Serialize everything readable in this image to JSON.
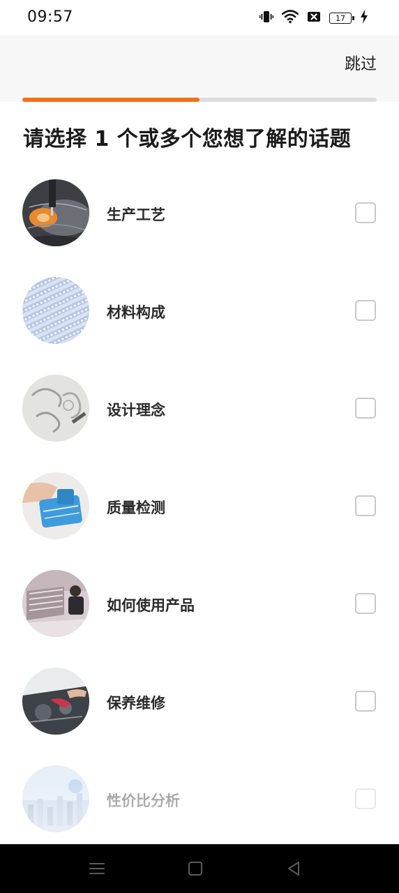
{
  "status_bar": {
    "time": "09:57",
    "battery_level": "17",
    "icons": [
      "vibrate-icon",
      "wifi-icon",
      "sim-blocked-icon",
      "battery-icon",
      "charging-icon"
    ]
  },
  "header": {
    "skip_label": "跳过",
    "progress_percent": 50,
    "progress_color": "#ef7119"
  },
  "title": "请选择 1 个或多个您想了解的话题",
  "topics": [
    {
      "label": "生产工艺",
      "checked": false,
      "thumb_icon": "sewing-machine-image"
    },
    {
      "label": "材料构成",
      "checked": false,
      "thumb_icon": "fabric-texture-image"
    },
    {
      "label": "设计理念",
      "checked": false,
      "thumb_icon": "design-sketch-image"
    },
    {
      "label": "质量检测",
      "checked": false,
      "thumb_icon": "quality-inspection-image"
    },
    {
      "label": "如何使用产品",
      "checked": false,
      "thumb_icon": "product-usage-image"
    },
    {
      "label": "保养维修",
      "checked": false,
      "thumb_icon": "maintenance-repair-image"
    },
    {
      "label": "性价比分析",
      "checked": false,
      "thumb_icon": "value-analysis-image"
    }
  ],
  "nav_bar": {
    "buttons": [
      "menu-icon",
      "home-icon",
      "back-icon"
    ]
  }
}
